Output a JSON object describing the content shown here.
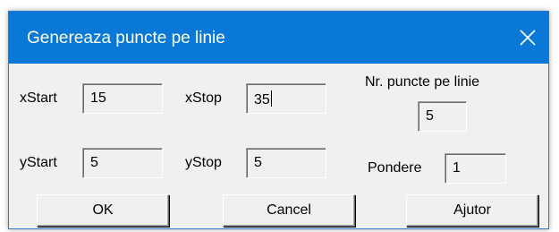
{
  "window": {
    "title": "Genereaza puncte pe linie",
    "close_icon": "close-icon",
    "accent_color": "#0a78d7"
  },
  "fields": {
    "xstart": {
      "label": "xStart",
      "value": "15"
    },
    "xstop": {
      "label": "xStop",
      "value": "35"
    },
    "nr_puncte": {
      "label": "Nr. puncte pe linie",
      "value": "5"
    },
    "ystart": {
      "label": "yStart",
      "value": "5"
    },
    "ystop": {
      "label": "yStop",
      "value": "5"
    },
    "pondere": {
      "label": "Pondere",
      "value": "1"
    }
  },
  "buttons": {
    "ok": "OK",
    "cancel": "Cancel",
    "help": "Ajutor"
  }
}
